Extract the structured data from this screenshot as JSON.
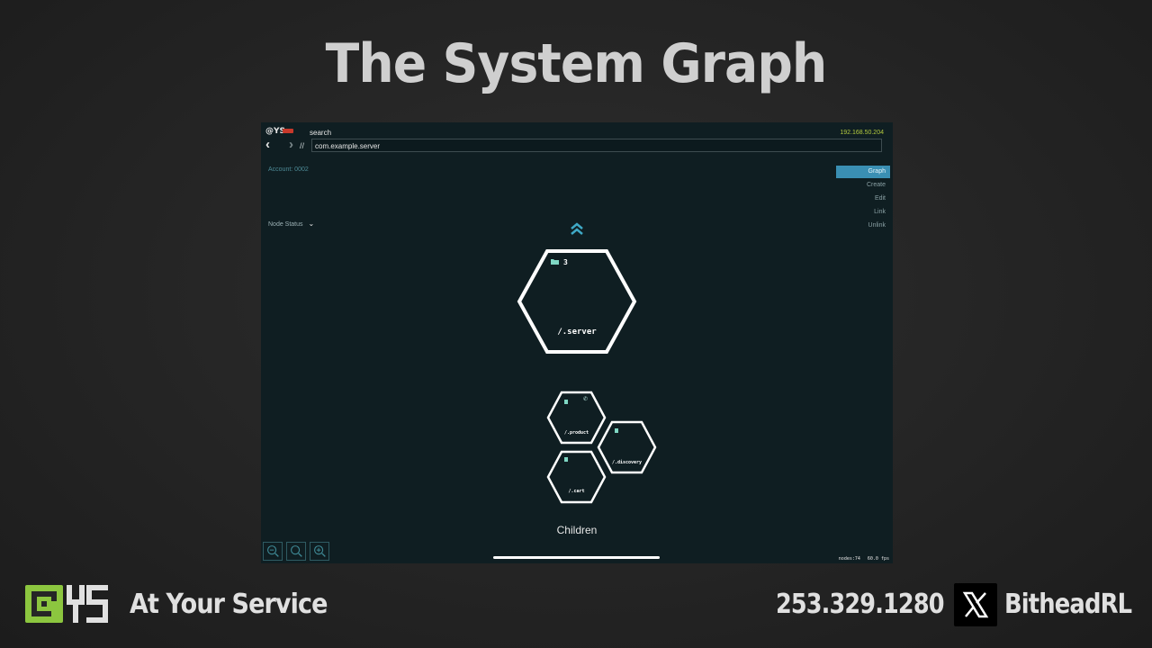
{
  "slide": {
    "title": "The System Graph"
  },
  "app": {
    "brand": "@YS",
    "search_label": "search",
    "ip_address": "192.168.50.204",
    "slashes": "//",
    "url_value": "com.example.server",
    "account": "Account: 0002",
    "node_status_label": "Node Status",
    "menu": [
      "Graph",
      "Create",
      "Edit",
      "Link",
      "Unlink"
    ],
    "menu_active": "Graph",
    "main_node": {
      "label": "/.server",
      "child_count": "3"
    },
    "child_nodes": [
      {
        "label": "/.product"
      },
      {
        "label": "/.discovery"
      },
      {
        "label": "/.cart"
      }
    ],
    "children_title": "Children",
    "stats": {
      "nodes": "nodes:74",
      "fps": "60.0 fps"
    },
    "colors": {
      "background": "#0f1e22",
      "accent": "#3a8fb3",
      "ip": "#b3c93e",
      "node_outline": "#ffffff"
    },
    "icons": [
      "back-arrow-icon",
      "forward-arrow-icon",
      "chevron-down-icon",
      "double-chevron-up-icon",
      "folder-icon",
      "document-icon",
      "phone-icon",
      "zoom-out-icon",
      "zoom-reset-icon",
      "zoom-in-icon"
    ]
  },
  "footer": {
    "logo_text": "@YS",
    "tagline": "At Your Service",
    "phone": "253.329.1280",
    "handle": "BitheadRL"
  }
}
